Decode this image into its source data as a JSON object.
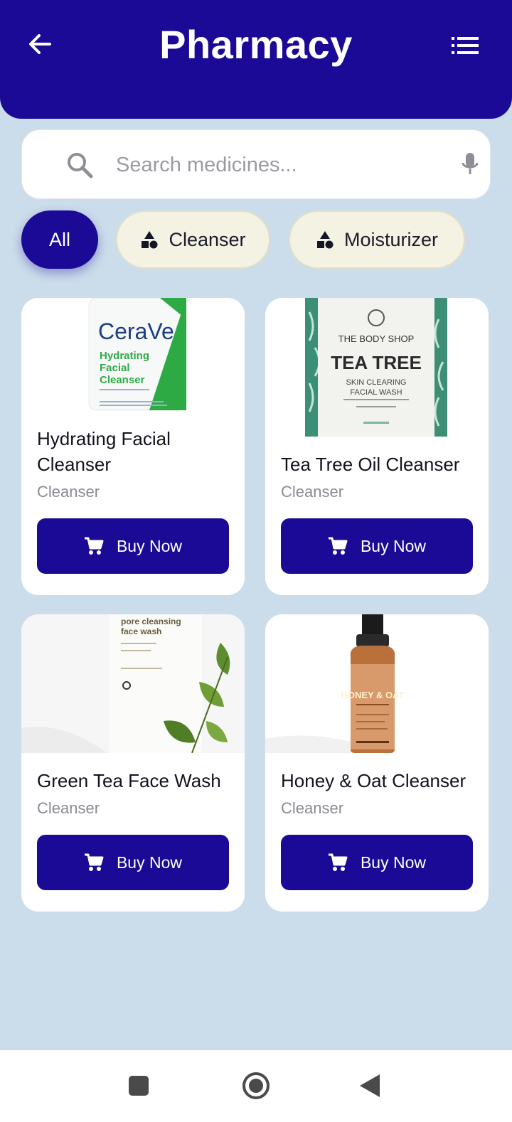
{
  "header": {
    "title": "Pharmacy",
    "back_icon": "arrow-left-icon",
    "menu_icon": "list-menu-icon",
    "bg_color": "#1a0a96"
  },
  "search": {
    "placeholder": "Search medicines...",
    "value": ""
  },
  "filters": [
    {
      "label": "All",
      "selected": true
    },
    {
      "label": "Cleanser",
      "selected": false
    },
    {
      "label": "Moisturizer",
      "selected": false
    }
  ],
  "products": [
    {
      "name": "Hydrating Facial Cleanser",
      "category": "Cleanser",
      "button": "Buy Now",
      "image_text": {
        "brand": "CeraVe",
        "line1": "Hydrating",
        "line2": "Facial",
        "line3": "Cleanser"
      }
    },
    {
      "name": "Tea Tree Oil Cleanser",
      "category": "Cleanser",
      "button": "Buy Now",
      "image_text": {
        "brand": "THE BODY SHOP",
        "line1": "TEA TREE",
        "line2": "SKIN CLEARING",
        "line3": "FACIAL WASH"
      }
    },
    {
      "name": "Green Tea Face Wash",
      "category": "Cleanser",
      "button": "Buy Now",
      "image_text": {
        "line1": "pore cleansing",
        "line2": "face wash"
      }
    },
    {
      "name": "Honey & Oat Cleanser",
      "category": "Cleanser",
      "button": "Buy Now",
      "image_text": {
        "line1": "HONEY & OAT"
      }
    }
  ],
  "colors": {
    "accent": "#1a0a96",
    "background": "#cbdcea",
    "chip_bg": "#f4f2e2"
  },
  "system_nav": {
    "icons": [
      "recents-square-icon",
      "home-circle-icon",
      "back-triangle-icon"
    ]
  }
}
